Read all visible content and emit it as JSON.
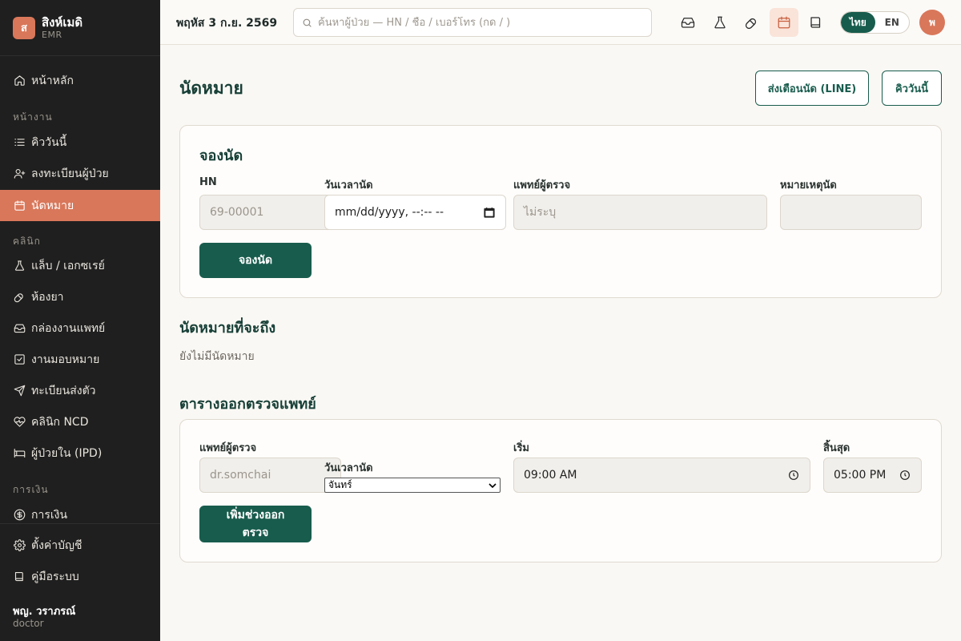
{
  "brand": {
    "logo_letter": "ส",
    "name": "สิงห์เมดิ",
    "sub": "EMR",
    "accent": "#d9775a",
    "primary": "#185c4d"
  },
  "sidebar": {
    "home": "หน้าหลัก",
    "section_work": "หน้างาน",
    "queue": "คิววันนี้",
    "register": "ลงทะเบียนผู้ป่วย",
    "appointments": "นัดหมาย",
    "section_clinic": "คลินิก",
    "lab": "แล็บ / เอกซเรย์",
    "pharmacy": "ห้องยา",
    "inbox": "กล่องงานแพทย์",
    "tasks": "งานมอบหมาย",
    "referral": "ทะเบียนส่งตัว",
    "ncd": "คลินิก NCD",
    "ipd": "ผู้ป่วยใน (IPD)",
    "section_finance": "การเงิน",
    "billing": "การเงิน",
    "settings": "ตั้งค่าบัญชี",
    "manual": "คู่มือระบบ",
    "user_name": "พญ. วราภรณ์",
    "user_role": "doctor"
  },
  "topbar": {
    "date": "พฤหัส 3 ก.ย. 2569",
    "search_placeholder": "ค้นหาผู้ป่วย — HN / ชื่อ / เบอร์โทร (กด / )",
    "lang_th": "ไทย",
    "lang_en": "EN",
    "avatar_letter": "พ"
  },
  "page": {
    "title": "นัดหมาย",
    "btn_remind": "ส่งเตือนนัด (LINE)",
    "btn_queue": "คิววันนี้"
  },
  "booking": {
    "title": "จองนัด",
    "hn_label": "HN",
    "hn_placeholder": "69-00001",
    "datetime_label": "วันเวลานัด",
    "datetime_value": "mm/dd/yyyy, --:-- --",
    "doctor_label": "แพทย์ผู้ตรวจ",
    "doctor_placeholder": "ไม่ระบุ",
    "note_label": "หมายเหตุนัด",
    "submit": "จองนัด"
  },
  "upcoming": {
    "title": "นัดหมายที่จะถึง",
    "empty": "ยังไม่มีนัดหมาย"
  },
  "schedule": {
    "title": "ตารางออกตรวจแพทย์",
    "doctor_label": "แพทย์ผู้ตรวจ",
    "doctor_placeholder": "dr.somchai",
    "day_label": "วันเวลานัด",
    "day_value": "จันทร์",
    "start_label": "เริ่ม",
    "start_value": "09:00 AM",
    "end_label": "สิ้นสุด",
    "end_value": "05:00 PM",
    "add_line1": "เพิ่มช่วงออก",
    "add_line2": "ตรวจ"
  }
}
